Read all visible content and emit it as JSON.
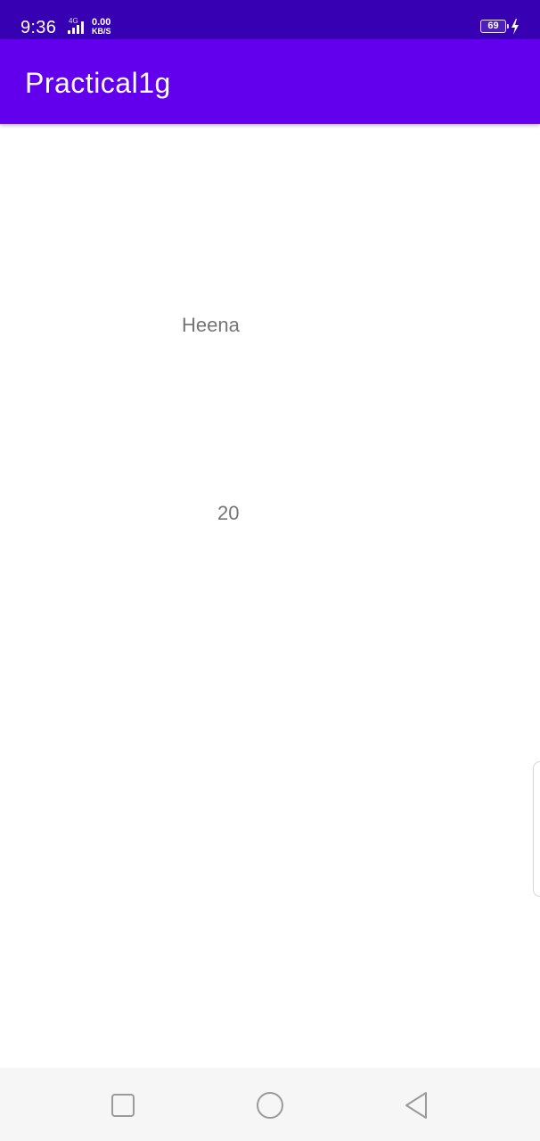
{
  "status_bar": {
    "time": "9:36",
    "network_type": "4G",
    "speed_value": "0.00",
    "speed_unit": "KB/S",
    "battery_level": "69",
    "icons": [
      "signal-icon",
      "battery-icon",
      "charging-icon"
    ]
  },
  "app_bar": {
    "title": "Practical1g"
  },
  "content": {
    "name_text": "Heena",
    "age_text": "20"
  },
  "nav_bar": {
    "icons": [
      "recents-icon",
      "home-icon",
      "back-icon"
    ]
  },
  "colors": {
    "status_bar": "#3700b3",
    "app_bar": "#6200ee",
    "text": "#757575",
    "nav_bar": "#f6f6f6"
  }
}
